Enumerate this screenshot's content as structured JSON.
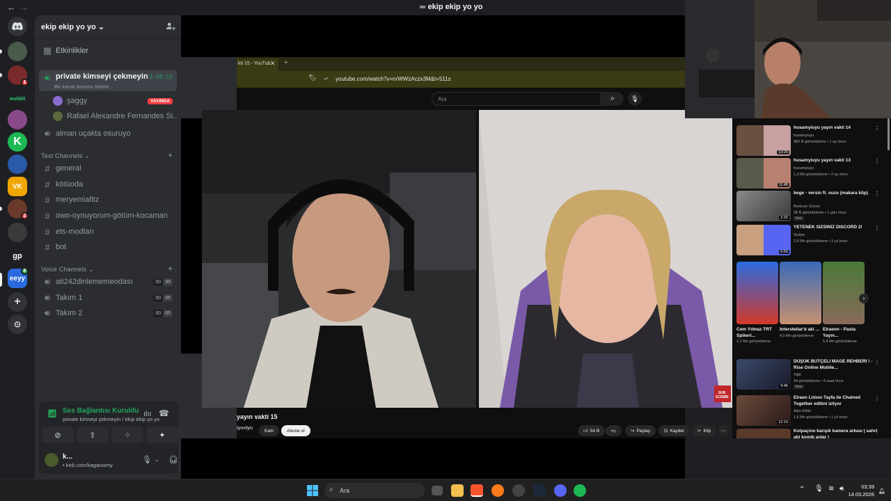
{
  "window": {
    "title": "ekip ekip yo yo"
  },
  "server": {
    "name": "ekip ekip yo yo"
  },
  "sidebar": {
    "events_label": "Etkinlikler",
    "active_voice": {
      "name": "private kimseyi çekmeyin",
      "timer": "3:50:15",
      "status_prompt": "Bir kanal durumu belirle",
      "members": [
        {
          "name": "şaggy",
          "badge": "YAYINDA"
        },
        {
          "name": "Rafael Alexandre Fernandes Si..."
        }
      ]
    },
    "other_voice": "alman uçakta osuruyo",
    "text_category": "Text Channels",
    "text_channels": [
      "general",
      "kötüoda",
      "meryemiafitz",
      "owo-oynuyorum-götüm-kocaman",
      "ets-modları",
      "bot"
    ],
    "voice_category": "Voice Channels",
    "voice_channels": [
      {
        "name": "ati242dinlememeodası",
        "count_a": "00",
        "count_b": "99"
      },
      {
        "name": "Takım 1",
        "count_a": "00",
        "count_b": "05"
      },
      {
        "name": "Takım 2",
        "count_a": "00",
        "count_b": "05"
      }
    ]
  },
  "servers": [
    {
      "label": "",
      "color": "#5865f2"
    },
    {
      "label": "",
      "color": "#4a5a4a"
    },
    {
      "label": "",
      "color": "#7a2a2a",
      "badge": "1"
    },
    {
      "label": "wubbit",
      "color": "#1e1f22"
    },
    {
      "label": "",
      "color": "#8a4a8a"
    },
    {
      "label": "K",
      "color": "#1db954"
    },
    {
      "label": "",
      "color": "#2a5aa8"
    },
    {
      "label": "VK",
      "color": "#f0a500"
    },
    {
      "label": "",
      "color": "#6a3a2a",
      "badge": "2"
    },
    {
      "label": "",
      "color": "#3a3a3a"
    },
    {
      "label": "gp",
      "color": "#1e1f22"
    },
    {
      "label": "eeyy",
      "color": "#2a6adf",
      "badge": "6"
    }
  ],
  "voice_panel": {
    "status": "Ses Bağlantısı Kuruldu",
    "channel_path": "private kimseyi çekmeyin / ekip ekip yo yo",
    "user_name": "k...",
    "user_status": "kick.com/kaganismy"
  },
  "browser": {
    "tab_title": "kti 15 - YouTub",
    "url": "youtube.com/watch?v=nrWWzAczx3M&t=511s",
    "search_placeholder": "Ara"
  },
  "video": {
    "title": "yayın vakti 15",
    "channel": "iyuviyu",
    "join_label": "Katıl",
    "subscribe_label": "Abone ol",
    "likes": "54 B",
    "share_label": "Paylaş",
    "save_label": "Kaydet",
    "clip_label": "Klip",
    "corner_tag": "SUB SCRIBE"
  },
  "recommendations": [
    {
      "title": "husamyiuyu yayın vakti 14",
      "channel": "husamyiuyu",
      "meta": "982 B görüntüleme • 1 ay önce",
      "duration": "13:29"
    },
    {
      "title": "husamyiuyu yayın vakti 13",
      "channel": "husamyiuyu",
      "meta": "1,3 Mn görüntüleme • 2 ay önce",
      "duration": "11:45"
    },
    {
      "title": "bege - versin ft. ouzo (makara klip)",
      "channel": "Berkcan Güven",
      "meta": "98 B görüntüleme • 1 gün önce",
      "duration": "2:32",
      "tag": "Yeni"
    },
    {
      "title": "YETENEK SİZSİNİZ DISCORD 2!",
      "channel": "Swiiye",
      "meta": "2,9 Mn görüntüleme • 3 yıl önce",
      "duration": "6:50"
    }
  ],
  "shorts": [
    {
      "name": "Cem Yılmaz TRT Spikeri...",
      "views": "2,1 Mn görüntüleme"
    },
    {
      "name": "Interstellar'd aki ...",
      "views": "4,5 Mn görüntüleme"
    },
    {
      "name": "Elraenn - Pasta Yayın...",
      "views": "5,4 Mn görüntüleme"
    }
  ],
  "recommendations2": [
    {
      "title": "DÜŞÜK BÜTÇELİ MAGE REHBERİ ! - Rise Online Mobile...",
      "channel": "Yiğit",
      "meta": "34 görüntüleme • 6 saat önce",
      "duration": "9:45",
      "tag": "Yeni"
    },
    {
      "title": "Elraen Limon Tayfa ile Chained Together editini izliyor",
      "channel": "Alpo Edits",
      "meta": "1,6 Mn görüntüleme • 1 yıl önce",
      "duration": "12:19"
    },
    {
      "title": "Kolpaçino karışık kamera arkası | sahri abi komik anlar |",
      "channel": "",
      "meta": "",
      "duration": ""
    }
  ],
  "taskbar": {
    "search_placeholder": "Ara",
    "time": "03:39",
    "date": "14.03.2026"
  }
}
